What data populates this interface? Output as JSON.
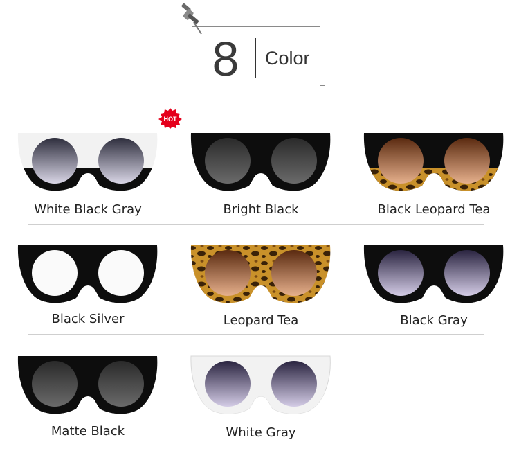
{
  "header": {
    "number": "8",
    "word": "Color"
  },
  "badge": {
    "text": "HOT"
  },
  "colors": {
    "white": "#f2f2f2",
    "black": "#0d0d0d",
    "tortoise_base": "#c9912a",
    "tortoise_spot": "#3a2208",
    "lens_gray_top": "#2e2e3d",
    "lens_gray_bottom": "#d9d6e6",
    "lens_purple_top": "#2a2440",
    "lens_purple_bottom": "#d4cce6",
    "lens_tea_top": "#5a2a10",
    "lens_tea_bottom": "#e6b08c",
    "lens_silver": "#fafafa",
    "lens_dark": "#3a3a3a"
  },
  "products": [
    {
      "label": "White Black Gray",
      "frame": "white-black",
      "lens": "gray",
      "hot": true
    },
    {
      "label": "Bright Black",
      "frame": "black",
      "lens": "dark"
    },
    {
      "label": "Black Leopard Tea",
      "frame": "black-leopard",
      "lens": "tea"
    },
    {
      "label": "Black Silver",
      "frame": "black",
      "lens": "silver"
    },
    {
      "label": "Leopard Tea",
      "frame": "leopard",
      "lens": "tea"
    },
    {
      "label": "Black Gray",
      "frame": "black",
      "lens": "purple"
    },
    {
      "label": "Matte Black",
      "frame": "black",
      "lens": "dark"
    },
    {
      "label": "White Gray",
      "frame": "white",
      "lens": "purple"
    }
  ]
}
